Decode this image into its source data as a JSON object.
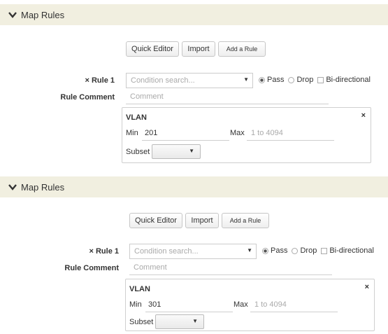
{
  "panels": [
    {
      "header": {
        "title": "Map Rules"
      },
      "buttons": {
        "quick_editor": "Quick Editor",
        "import": "Import",
        "add_rule": "Add a Rule"
      },
      "rule": {
        "remove_icon": "×",
        "label": "Rule 1",
        "condition_placeholder": "Condition search...",
        "pass_label": "Pass",
        "drop_label": "Drop",
        "bidirectional_label": "Bi-directional",
        "selected": "Pass",
        "comment_label": "Rule Comment",
        "comment_placeholder": "Comment"
      },
      "vlan": {
        "title": "VLAN",
        "close_icon": "×",
        "min_label": "Min",
        "min_value": "201",
        "max_label": "Max",
        "max_placeholder": "1 to 4094",
        "subset_label": "Subset",
        "subset_value": ""
      }
    },
    {
      "header": {
        "title": "Map Rules"
      },
      "buttons": {
        "quick_editor": "Quick Editor",
        "import": "Import",
        "add_rule": "Add a Rule"
      },
      "rule": {
        "remove_icon": "×",
        "label": "Rule 1",
        "condition_placeholder": "Condition search...",
        "pass_label": "Pass",
        "drop_label": "Drop",
        "bidirectional_label": "Bi-directional",
        "selected": "Pass",
        "comment_label": "Rule Comment",
        "comment_placeholder": "Comment"
      },
      "vlan": {
        "title": "VLAN",
        "close_icon": "×",
        "min_label": "Min",
        "min_value": "301",
        "max_label": "Max",
        "max_placeholder": "1 to 4094",
        "subset_label": "Subset",
        "subset_value": ""
      }
    }
  ],
  "colors": {
    "header_bg": "#f1efe0",
    "border": "#cfcfcf",
    "placeholder": "#aaaaaa"
  }
}
